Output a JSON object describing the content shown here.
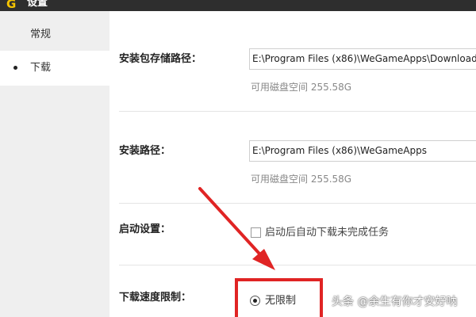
{
  "window": {
    "logo": "G",
    "title": "设置"
  },
  "sidebar": {
    "items": [
      {
        "label": "常规"
      },
      {
        "label": "下载"
      }
    ]
  },
  "download": {
    "package_path": {
      "label": "安装包存储路径：",
      "value": "E:\\Program Files (x86)\\WeGameApps\\Download",
      "free_space": "可用磁盘空间 255.58G"
    },
    "install_path": {
      "label": "安装路径：",
      "value": "E:\\Program Files (x86)\\WeGameApps",
      "free_space": "可用磁盘空间 255.58G"
    },
    "startup": {
      "label": "启动设置：",
      "checkbox_label": "启动后自动下载未完成任务",
      "checked": false
    },
    "speed_limit": {
      "label": "下载速度限制：",
      "option_label": "无限制",
      "selected": true
    }
  },
  "annotation": {
    "color": "#e02424"
  },
  "watermark": "头条 @余生有你才安好呐"
}
